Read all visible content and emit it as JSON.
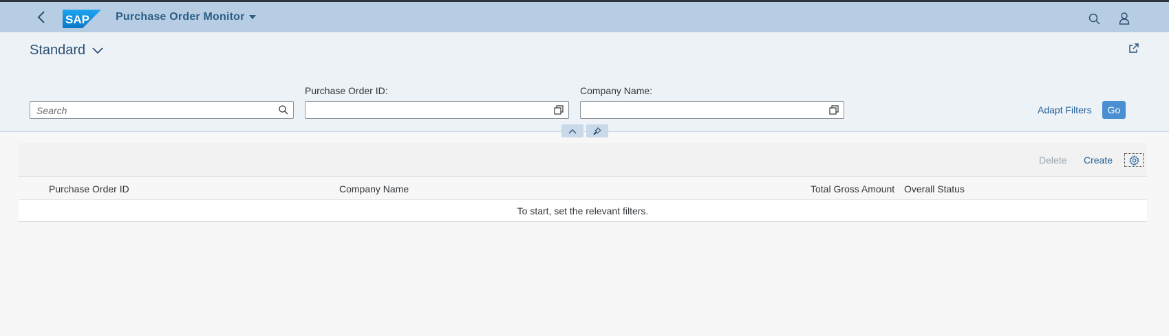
{
  "shell": {
    "app_title": "Purchase Order Monitor",
    "logo_text": "SAP"
  },
  "header": {
    "variant_name": "Standard"
  },
  "filters": {
    "search_placeholder": "Search",
    "purchase_order_label": "Purchase Order ID:",
    "company_name_label": "Company Name:",
    "adapt_filters_label": "Adapt Filters",
    "go_label": "Go"
  },
  "table": {
    "toolbar": {
      "delete_label": "Delete",
      "create_label": "Create"
    },
    "columns": [
      "Purchase Order ID",
      "Company Name",
      "Total Gross Amount",
      "Overall Status"
    ],
    "empty_text": "To start, set the relevant filters."
  },
  "colors": {
    "shell_bar": "#b7cde3",
    "header_bg": "#edf2f7",
    "accent": "#4a8fd1",
    "link": "#1f5f97"
  },
  "icons": [
    "back-icon",
    "sap-logo",
    "dropdown-triangle-icon",
    "search-icon",
    "user-icon",
    "chevron-down-icon",
    "share-icon",
    "value-help-icon",
    "collapse-icon",
    "pin-icon",
    "settings-icon"
  ]
}
